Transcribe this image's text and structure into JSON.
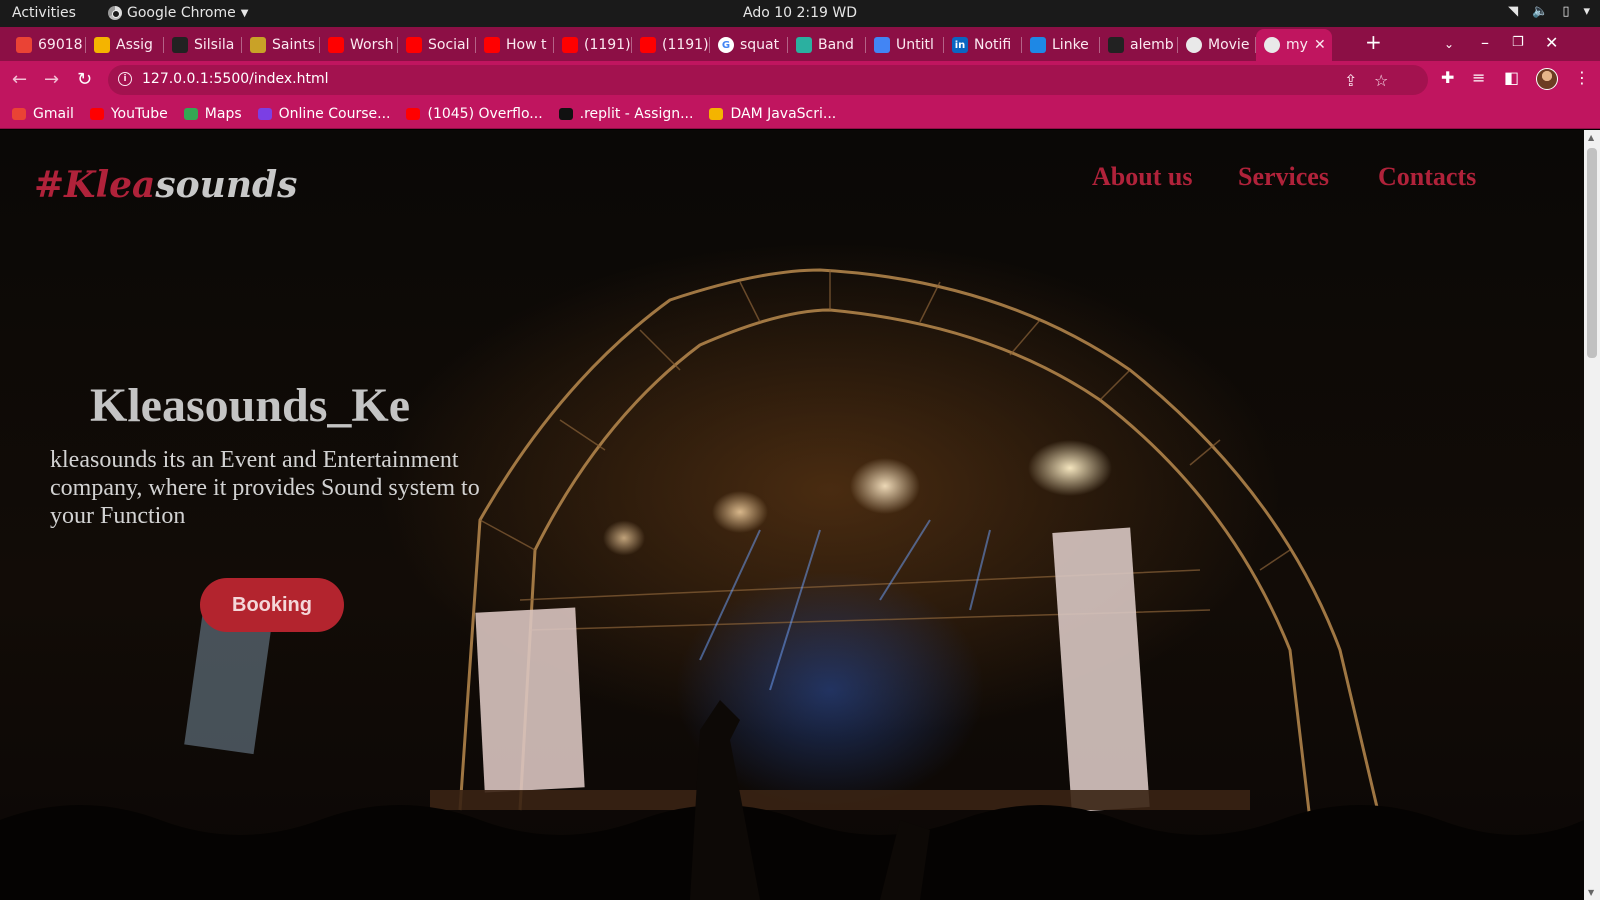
{
  "system_bar": {
    "activities": "Activities",
    "app_name": "Google Chrome",
    "clock": "Ado 10  2:19 WD"
  },
  "tabs": [
    {
      "label": "69018",
      "icon": "gmail-icon"
    },
    {
      "label": "Assig",
      "icon": "classroom-icon"
    },
    {
      "label": "Silsila",
      "icon": "github-icon"
    },
    {
      "label": "Saints",
      "icon": "shield-icon"
    },
    {
      "label": "Worsh",
      "icon": "youtube-icon"
    },
    {
      "label": "Social",
      "icon": "youtube-icon"
    },
    {
      "label": "How t",
      "icon": "youtube-icon"
    },
    {
      "label": "(1191)",
      "icon": "youtube-icon"
    },
    {
      "label": "(1191)",
      "icon": "youtube-icon"
    },
    {
      "label": "squat",
      "icon": "google-icon"
    },
    {
      "label": "Band",
      "icon": "band-icon"
    },
    {
      "label": "Untitl",
      "icon": "docs-icon"
    },
    {
      "label": "Notifi",
      "icon": "linkedin-icon"
    },
    {
      "label": "Linke",
      "icon": "video-icon"
    },
    {
      "label": "alemb",
      "icon": "github-icon"
    },
    {
      "label": "Movie",
      "icon": "globe-icon"
    },
    {
      "label": "my",
      "icon": "globe-icon",
      "active": true
    }
  ],
  "address_bar": {
    "url": "127.0.0.1:5500/index.html"
  },
  "bookmarks": [
    {
      "label": "Gmail",
      "color": "#ea4335"
    },
    {
      "label": "YouTube",
      "color": "#ff0000"
    },
    {
      "label": "Maps",
      "color": "#34a853"
    },
    {
      "label": "Online Course...",
      "color": "#7b3fe4"
    },
    {
      "label": "(1045) Overflo...",
      "color": "#ff0000"
    },
    {
      "label": ".replit - Assign...",
      "color": "#111111"
    },
    {
      "label": "DAM JavaScri...",
      "color": "#f4b400"
    }
  ],
  "site": {
    "logo_part1": "#Klea",
    "logo_part2": "sounds",
    "nav": [
      "About us",
      "Services",
      "Contacts"
    ],
    "hero_title": "Kleasounds_Ke",
    "hero_text": "kleasounds its an Event and Entertainment company, where it provides Sound system to your Function",
    "cta": "Booking"
  },
  "colors": {
    "browser_accent": "#c0155f",
    "brand_red": "#b0223a",
    "button_red": "#b3242e"
  }
}
